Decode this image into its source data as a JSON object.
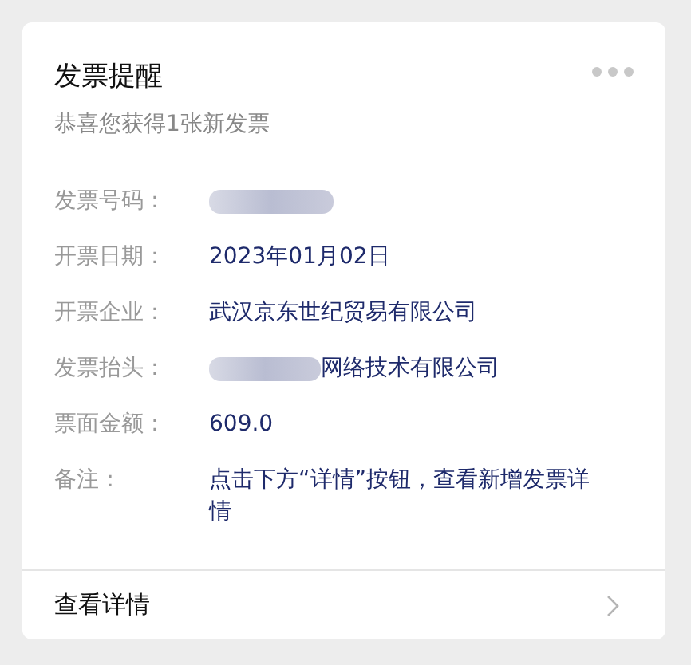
{
  "card": {
    "title": "发票提醒",
    "subtitle": "恭喜您获得1张新发票",
    "fields": [
      {
        "label": "发票号码：",
        "redacted": true
      },
      {
        "label": "开票日期：",
        "value": "2023年01月02日",
        "redacted": false
      },
      {
        "label": "开票企业：",
        "value": "武汉京东世纪贸易有限公司",
        "redacted": false
      },
      {
        "label": "发票抬头：",
        "value": "网络技术有限公司",
        "redacted": true
      },
      {
        "label": "票面金额：",
        "value": "609.0",
        "redacted": false
      },
      {
        "label": "备注：",
        "value": "点击下方“详情”按钮，查看新增发票详情",
        "redacted": false
      }
    ],
    "footer": {
      "label": "查看详情"
    }
  }
}
